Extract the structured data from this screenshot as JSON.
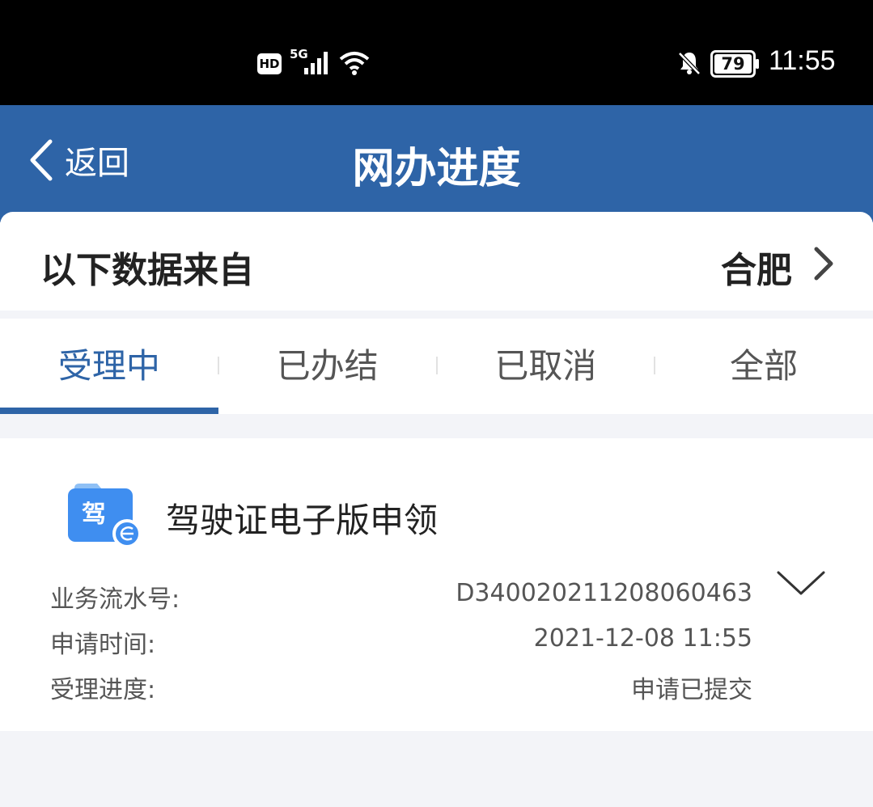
{
  "status_bar": {
    "hd": "HD",
    "network": "5G",
    "battery": "79",
    "time": "11:55",
    "icons": [
      "signal-icon",
      "wifi-icon",
      "bell-muted-icon",
      "battery-icon"
    ]
  },
  "nav": {
    "back_label": "返回",
    "title": "网办进度"
  },
  "source": {
    "label": "以下数据来自",
    "city": "合肥"
  },
  "tabs": [
    {
      "label": "受理中"
    },
    {
      "label": "已办结"
    },
    {
      "label": "已取消"
    },
    {
      "label": "全部"
    }
  ],
  "record": {
    "icon_char": "驾",
    "title": "驾驶证电子版申领",
    "fields": [
      {
        "label": "业务流水号:",
        "value": "D340020211208060463"
      },
      {
        "label": "申请时间:",
        "value": "2021-12-08 11:55"
      },
      {
        "label": "受理进度:",
        "value": "申请已提交"
      }
    ]
  },
  "colors": {
    "brand": "#2e64a7",
    "icon_blue": "#3f8ef0"
  }
}
